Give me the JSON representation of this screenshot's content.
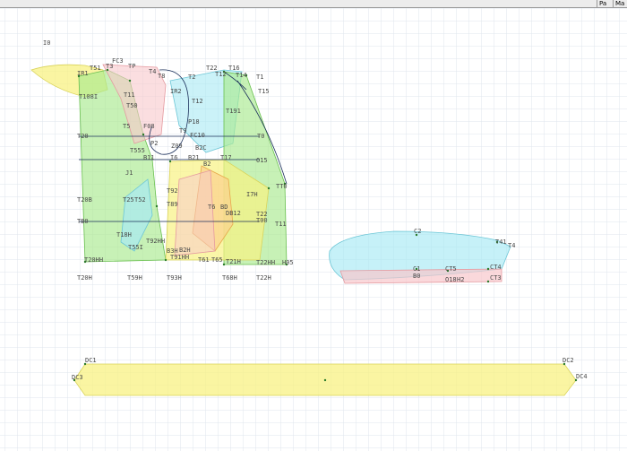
{
  "toolbar": {
    "btn1": "Pa",
    "btn2": "Ma"
  },
  "colors": {
    "grid": "#dfe6ec",
    "yellow": "#f8f283",
    "green": "#a9ea8f",
    "cyan": "#a8eaf4",
    "pink": "#f8c8cc",
    "orange": "#fbd28d",
    "line": "#1b2f5a",
    "point": "#2a7a2a"
  },
  "labels": {
    "origin": "I0",
    "t3": "T3",
    "fc3": "FC3",
    "tp": "TP",
    "t4": "T4",
    "t8": "T8",
    "t2": "T2",
    "t22": "T22",
    "t12": "T12",
    "t16": "T16",
    "t14": "T14",
    "t15": "T15",
    "t1": "T1",
    "ir1": "IR1",
    "t51": "T51",
    "ir2": "IR2",
    "t9": "T9",
    "t60": "T60",
    "fc10": "FC10",
    "t0": "T0",
    "t555": "T555",
    "b11": "B11",
    "i6": "I6",
    "z09": "Z09",
    "b2c": "B2C",
    "b21": "B21",
    "t17": "T17",
    "b2": "B2",
    "o15": "O15",
    "j1": "J1",
    "tt0": "TT0",
    "i7h": "I7H",
    "t92": "T92",
    "t89": "T89",
    "t6": "T6",
    "bd": "BD",
    "db12": "DB12",
    "t22b": "T22",
    "t00": "T00",
    "t11": "T11",
    "t20b": "T20B",
    "t25": "T25",
    "t52": "T52",
    "tb0": "TB0",
    "t18h": "T18H",
    "t92hh": "T92HH",
    "t55i": "T55I",
    "b2h": "B2H",
    "t20hh": "T20HH",
    "b3h": "B3H",
    "t91hh": "T91HH",
    "t61": "T61",
    "t65": "T65",
    "t21h": "T21H",
    "t22hh": "T22HH",
    "h05": "H05",
    "t20h": "T20H",
    "t59h": "T59H",
    "t93h": "T93H",
    "t68h": "T68H",
    "t22h": "T22H",
    "t1081": "T108I",
    "t11b": "T11",
    "t50": "T50",
    "t12b": "T12",
    "t191": "T191",
    "t5": "T5",
    "f08": "F08",
    "p18": "P18",
    "p2": "P2",
    "t20a": "T20",
    "c2": "C2",
    "t41": "T41",
    "t4b": "T4",
    "c1": "C1",
    "ct5": "CT5",
    "ct4": "CT4",
    "b0": "B0",
    "ct3": "CT3",
    "o18": "O18",
    "h2": "H2",
    "dc1": "DC1",
    "dc2": "DC2",
    "dc3": "DC3",
    "dc4": "DC4"
  }
}
